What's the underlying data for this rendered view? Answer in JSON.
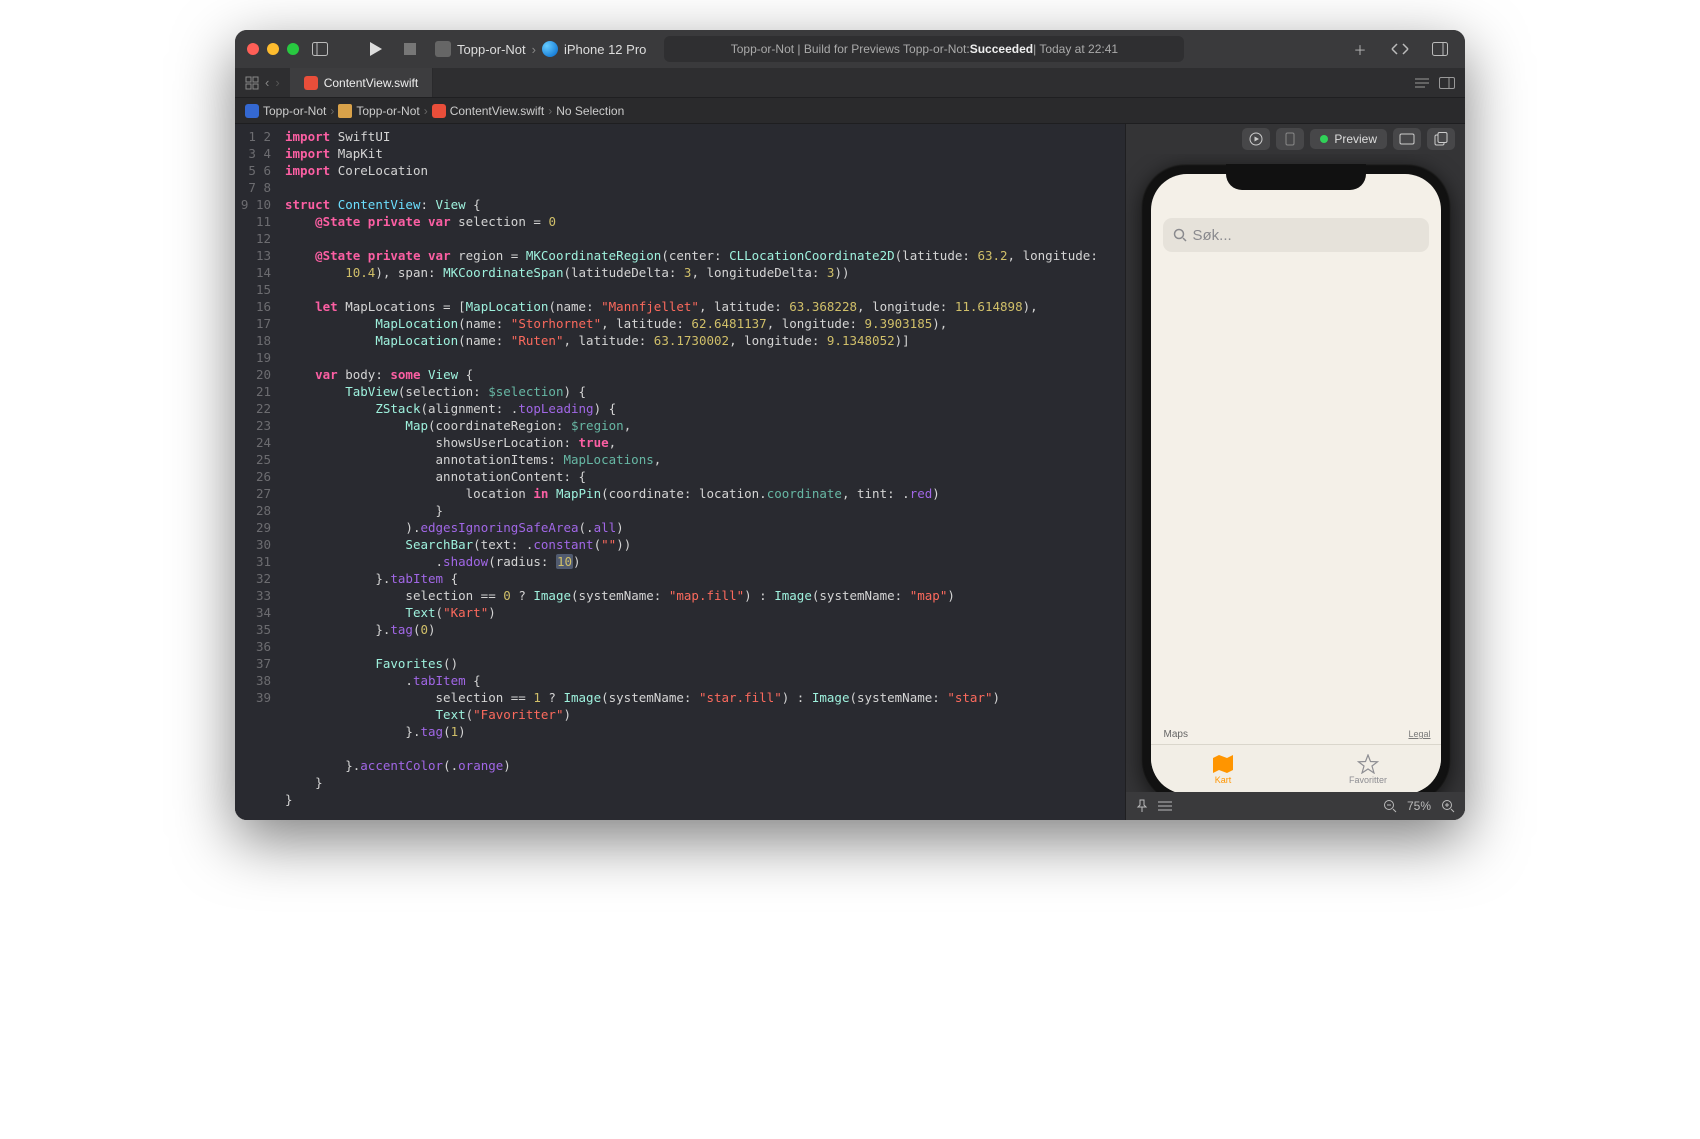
{
  "titlebar": {
    "scheme_name": "Topp-or-Not",
    "destination": "iPhone 12 Pro",
    "status_prefix": "Topp-or-Not | Build for Previews Topp-or-Not: ",
    "status_result": "Succeeded",
    "status_time": " | Today at 22:41"
  },
  "tab": {
    "filename": "ContentView.swift"
  },
  "breadcrumb": {
    "proj": "Topp-or-Not",
    "folder": "Topp-or-Not",
    "file": "ContentView.swift",
    "selection": "No Selection"
  },
  "code": {
    "lines": 39,
    "l1a": "import",
    "l1b": "SwiftUI",
    "l2a": "import",
    "l2b": "MapKit",
    "l3a": "import",
    "l3b": "CoreLocation",
    "l5a": "struct",
    "l5b": "ContentView",
    "l5c": "View",
    "l6a": "@State",
    "l6b": "private",
    "l6c": "var",
    "l6d": "selection = ",
    "l6e": "0",
    "l8a": "@State",
    "l8b": "private",
    "l8c": "var",
    "l8d": "region = ",
    "l8e": "MKCoordinateRegion",
    "l8f": "(center: ",
    "l8g": "CLLocationCoordinate2D",
    "l8h": "(latitude: ",
    "l8i": "63.2",
    "l8j": ", longitude: ",
    "l8k": "10.4",
    "l8l": "), span: ",
    "l8m": "MKCoordinateSpan",
    "l8n": "(latitudeDelta: ",
    "l8o": "3",
    "l8p": ", longitudeDelta: ",
    "l8q": "3",
    "l8r": "))",
    "l10a": "let",
    "l10b": "MapLocations = [",
    "l10c": "MapLocation",
    "l10d": "(name: ",
    "l10e": "\"Mannfjellet\"",
    "l10f": ", latitude: ",
    "l10g": "63.368228",
    "l10h": ", longitude: ",
    "l10i": "11.614898",
    "l10j": "),",
    "l11a": "MapLocation",
    "l11b": "(name: ",
    "l11c": "\"Storhornet\"",
    "l11d": ", latitude: ",
    "l11e": "62.6481137",
    "l11f": ", longitude: ",
    "l11g": "9.3903185",
    "l11h": "),",
    "l12a": "MapLocation",
    "l12b": "(name: ",
    "l12c": "\"Ruten\"",
    "l12d": ", latitude: ",
    "l12e": "63.1730002",
    "l12f": ", longitude: ",
    "l12g": "9.1348052",
    "l12h": ")]",
    "l14a": "var",
    "l14b": "body: ",
    "l14c": "some",
    "l14d": "View",
    "l14e": " {",
    "l15a": "TabView",
    "l15b": "(selection: ",
    "l15c": "$selection",
    "l15d": ") {",
    "l16a": "ZStack",
    "l16b": "(alignment: .",
    "l16c": "topLeading",
    "l16d": ") {",
    "l17a": "Map",
    "l17b": "(coordinateRegion: ",
    "l17c": "$region",
    "l17d": ",",
    "l18a": "showsUserLocation: ",
    "l18b": "true",
    "l18c": ",",
    "l19a": "annotationItems: ",
    "l19b": "MapLocations",
    "l19c": ",",
    "l20a": "annotationContent: {",
    "l21a": "location ",
    "l21b": "in",
    "l21c": "MapPin",
    "l21d": "(coordinate: location.",
    "l21e": "coordinate",
    "l21f": ", tint: .",
    "l21g": "red",
    "l21h": ")",
    "l22a": "}",
    "l23a": ").",
    "l23b": "edgesIgnoringSafeArea",
    "l23c": "(.",
    "l23d": "all",
    "l23e": ")",
    "l24a": "SearchBar",
    "l24b": "(text: .",
    "l24c": "constant",
    "l24d": "(",
    "l24e": "\"\"",
    "l24f": "))",
    "l25a": ".",
    "l25b": "shadow",
    "l25c": "(radius: ",
    "l25d": "10",
    "l25e": ")",
    "l26a": "}.",
    "l26b": "tabItem",
    "l26c": " {",
    "l27a": "selection == ",
    "l27b": "0",
    "l27c": " ? ",
    "l27d": "Image",
    "l27e": "(systemName: ",
    "l27f": "\"map.fill\"",
    "l27g": ") : ",
    "l27h": "Image",
    "l27i": "(systemName: ",
    "l27j": "\"map\"",
    "l27k": ")",
    "l28a": "Text",
    "l28b": "(",
    "l28c": "\"Kart\"",
    "l28d": ")",
    "l29a": "}.",
    "l29b": "tag",
    "l29c": "(",
    "l29d": "0",
    "l29e": ")",
    "l31a": "Favorites",
    "l31b": "()",
    "l32a": ".",
    "l32b": "tabItem",
    "l32c": " {",
    "l33a": "selection == ",
    "l33b": "1",
    "l33c": " ? ",
    "l33d": "Image",
    "l33e": "(systemName: ",
    "l33f": "\"star.fill\"",
    "l33g": ") : ",
    "l33h": "Image",
    "l33i": "(systemName: ",
    "l33j": "\"star\"",
    "l33k": ")",
    "l34a": "Text",
    "l34b": "(",
    "l34c": "\"Favoritter\"",
    "l34d": ")",
    "l35a": "}.",
    "l35b": "tag",
    "l35c": "(",
    "l35d": "1",
    "l35e": ")",
    "l37a": "}.",
    "l37b": "accentColor",
    "l37c": "(.",
    "l37d": "orange",
    "l37e": ")"
  },
  "preview": {
    "label": "Preview",
    "search_placeholder": "Søk...",
    "footer_brand": "Maps",
    "footer_legal": "Legal",
    "tab1": "Kart",
    "tab2": "Favoritter",
    "zoom": "75%"
  }
}
